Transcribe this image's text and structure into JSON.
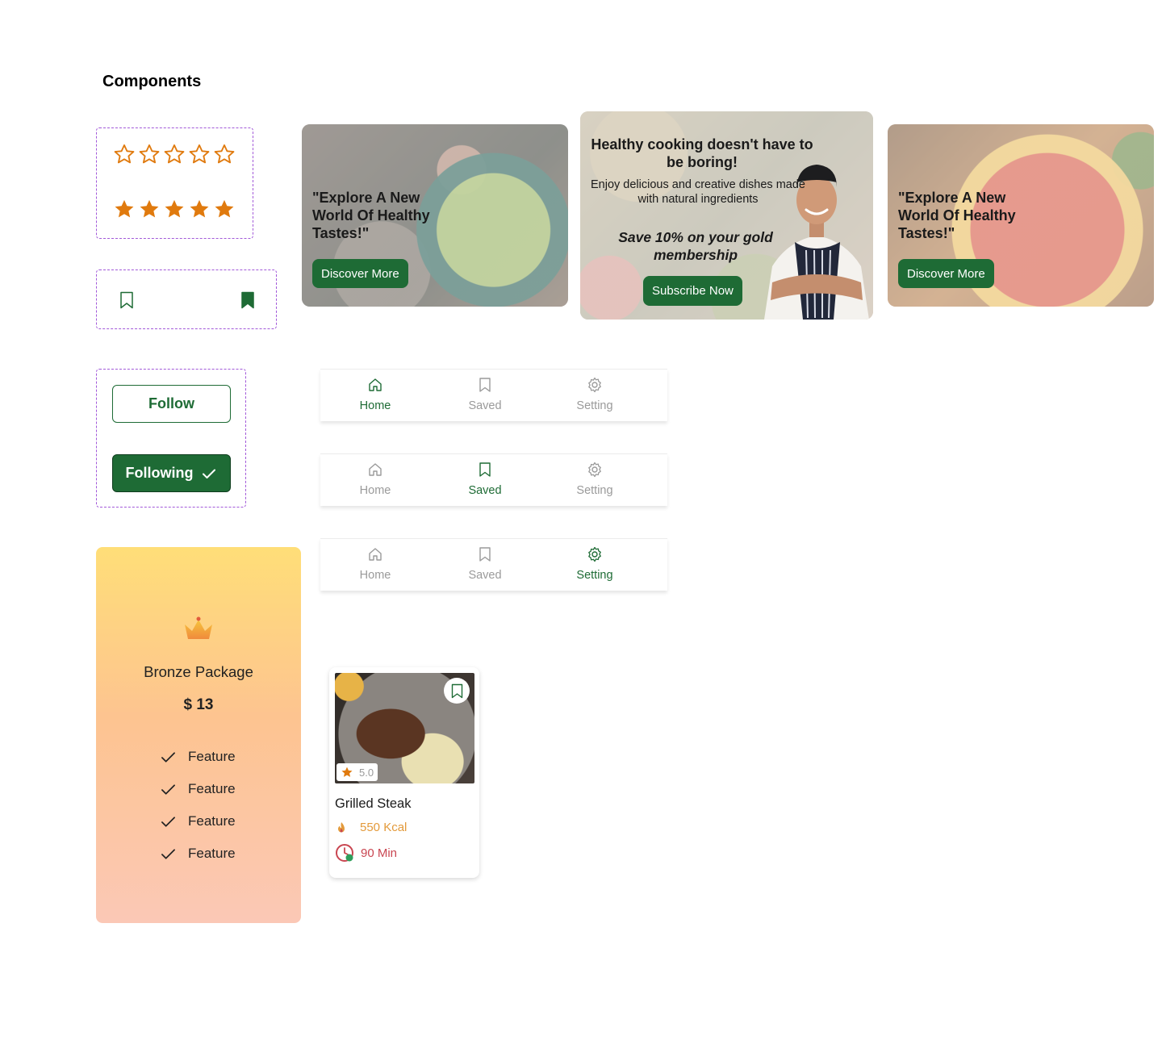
{
  "page": {
    "title": "Components"
  },
  "ratings": {
    "empty_count": 5,
    "filled_count": 5,
    "star_color": "#E07A0E"
  },
  "bookmarks": {
    "items": [
      "bookmark-outline",
      "bookmark-filled"
    ],
    "color": "#1E6B35"
  },
  "follow": {
    "follow_label": "Follow",
    "following_label": "Following"
  },
  "banners": [
    {
      "text": "\"Explore A New World Of Healthy Tastes!\"",
      "button": "Discover More"
    },
    {
      "headline": "Healthy cooking doesn't have to be boring!",
      "subtext": "Enjoy delicious and creative dishes made with natural ingredients",
      "offer": "Save 10% on your gold membership",
      "button": "Subscribe Now"
    },
    {
      "text": "\"Explore A New World Of Healthy Tastes!\"",
      "button": "Discover More"
    }
  ],
  "navbars": [
    {
      "active": "Home",
      "items": [
        "Home",
        "Saved",
        "Setting"
      ]
    },
    {
      "active": "Saved",
      "items": [
        "Home",
        "Saved",
        "Setting"
      ]
    },
    {
      "active": "Setting",
      "items": [
        "Home",
        "Saved",
        "Setting"
      ]
    }
  ],
  "package": {
    "name": "Bronze Package",
    "price": "$ 13",
    "features": [
      "Feature",
      "Feature",
      "Feature",
      "Feature"
    ]
  },
  "recipe_card": {
    "title": "Grilled Steak",
    "rating": "5.0",
    "calories": "550 Kcal",
    "time": "90 Min"
  },
  "colors": {
    "brand_green": "#1E6B35",
    "star_orange": "#E07A0E",
    "dashed_purple": "#A259D9",
    "kcal_orange": "#E39A3B",
    "time_red": "#C94651"
  }
}
